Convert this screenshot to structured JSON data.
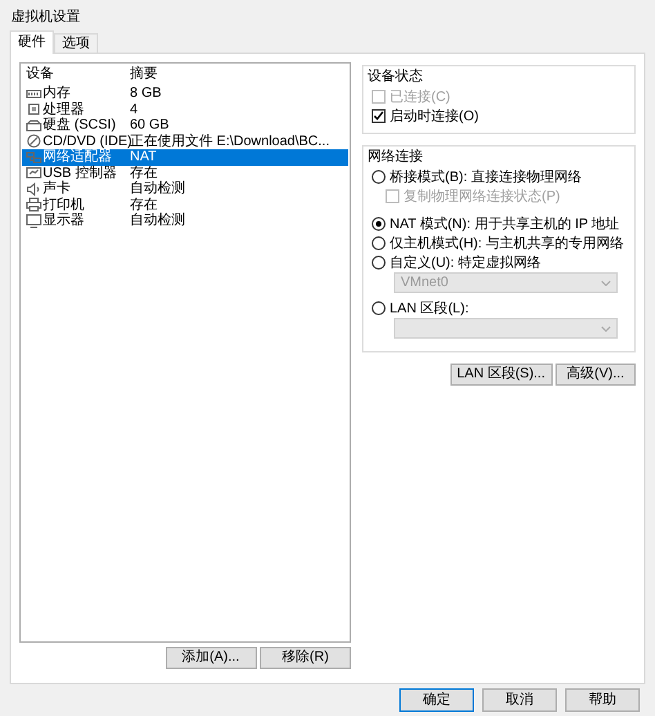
{
  "window": {
    "title": "虚拟机设置"
  },
  "tabs": [
    {
      "label": "硬件",
      "selected": true
    },
    {
      "label": "选项",
      "selected": false
    }
  ],
  "device_table": {
    "columns": [
      "设备",
      "摘要"
    ],
    "rows": [
      {
        "kind": "memory",
        "device": "内存",
        "summary": "8 GB",
        "selected": false
      },
      {
        "kind": "cpu",
        "device": "处理器",
        "summary": "4",
        "selected": false
      },
      {
        "kind": "disk",
        "device": "硬盘 (SCSI)",
        "summary": "60 GB",
        "selected": false
      },
      {
        "kind": "cd",
        "device": "CD/DVD (IDE)",
        "summary": "正在使用文件 E:\\Download\\BC...",
        "selected": false
      },
      {
        "kind": "network",
        "device": "网络适配器",
        "summary": "NAT",
        "selected": true
      },
      {
        "kind": "usb",
        "device": "USB 控制器",
        "summary": "存在",
        "selected": false
      },
      {
        "kind": "sound",
        "device": "声卡",
        "summary": "自动检测",
        "selected": false
      },
      {
        "kind": "printer",
        "device": "打印机",
        "summary": "存在",
        "selected": false
      },
      {
        "kind": "display",
        "device": "显示器",
        "summary": "自动检测",
        "selected": false
      }
    ]
  },
  "list_buttons": [
    "添加(A)...",
    "移除(R)"
  ],
  "device_status": {
    "title": "设备状态",
    "checkboxes": [
      {
        "label": "已连接(C)",
        "checked": false,
        "disabled": true
      },
      {
        "label": "启动时连接(O)",
        "checked": true,
        "disabled": false
      }
    ]
  },
  "network_connection": {
    "title": "网络连接",
    "options": [
      {
        "kind": "radio",
        "label": "桥接模式(B): 直接连接物理网络",
        "selected": false,
        "disabled": false
      },
      {
        "kind": "checkbox",
        "label": "复制物理网络连接状态(P)",
        "checked": false,
        "disabled": true
      },
      {
        "kind": "radio",
        "label": "NAT 模式(N): 用于共享主机的 IP 地址",
        "selected": true,
        "disabled": false
      },
      {
        "kind": "radio",
        "label": "仅主机模式(H): 与主机共享的专用网络",
        "selected": false,
        "disabled": false
      },
      {
        "kind": "radio",
        "label": "自定义(U): 特定虚拟网络",
        "selected": false,
        "disabled": false
      },
      {
        "kind": "select",
        "value": "VMnet0",
        "disabled": true
      },
      {
        "kind": "radio",
        "label": "LAN 区段(L):",
        "selected": false,
        "disabled": false
      },
      {
        "kind": "select",
        "disabled": true
      }
    ]
  },
  "network_buttons": [
    "LAN 区段(S)...",
    "高级(V)..."
  ],
  "footer_buttons": [
    {
      "label": "确定",
      "default": true
    },
    {
      "label": "取消",
      "default": false
    },
    {
      "label": "帮助",
      "default": false
    }
  ]
}
